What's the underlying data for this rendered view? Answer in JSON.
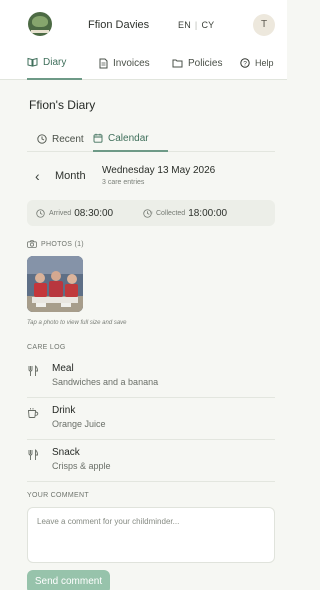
{
  "header": {
    "user_name": "Ffion Davies",
    "lang_en": "EN",
    "lang_sep": "|",
    "lang_cy": "CY",
    "avatar_initial": "T"
  },
  "main_tabs": {
    "diary": "Diary",
    "invoices": "Invoices",
    "policies": "Policies",
    "help": "Help"
  },
  "page": {
    "title": "Ffion's Diary"
  },
  "sub_tabs": {
    "recent": "Recent",
    "calendar": "Calendar"
  },
  "date_nav": {
    "period": "Month",
    "date": "Wednesday 13 May 2026",
    "entries": "3 care entries"
  },
  "times": {
    "arrived_label": "Arrived",
    "arrived_value": "08:30:00",
    "collected_label": "Collected",
    "collected_value": "18:00:00"
  },
  "photos": {
    "heading": "PHOTOS (1)",
    "hint": "Tap a photo to view full size and save"
  },
  "care_log": {
    "heading": "CARE LOG",
    "items": [
      {
        "title": "Meal",
        "detail": "Sandwiches and a banana",
        "icon": "cutlery-icon"
      },
      {
        "title": "Drink",
        "detail": "Orange Juice",
        "icon": "cup-icon"
      },
      {
        "title": "Snack",
        "detail": "Crisps & apple",
        "icon": "cutlery-icon"
      }
    ]
  },
  "comment": {
    "heading": "YOUR COMMENT",
    "placeholder": "Leave a comment for your childminder...",
    "send_label": "Send comment"
  },
  "colors": {
    "accent": "#3f6f5b",
    "accent_underline": "#6e9a87",
    "button": "#97c3ab",
    "background": "#f6f7f3"
  }
}
